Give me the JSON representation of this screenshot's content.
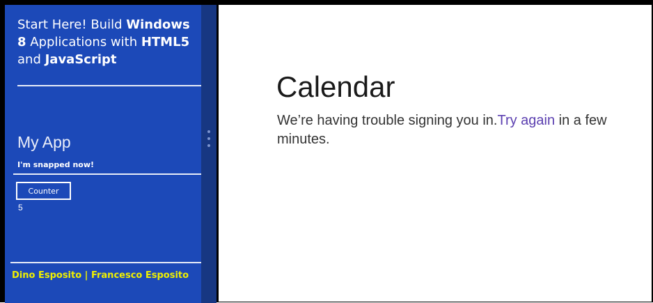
{
  "colors": {
    "snapped_panel": "#1c49b8",
    "splitter": "#173782",
    "author_text": "#f0f000",
    "link": "#5b3fb0"
  },
  "snapped_app": {
    "book_title": {
      "part1": "Start Here! Build ",
      "bold1": "Windows 8",
      "part2": " Applications with ",
      "bold2": "HTML5",
      "part3": " and ",
      "bold3": "JavaScript"
    },
    "app_title": "My App",
    "status_text": "I'm snapped now!",
    "counter_button_label": "Counter",
    "counter_value": "5",
    "authors": "Dino Esposito | Francesco Esposito"
  },
  "splitter": {
    "icon": "grip-dots-icon"
  },
  "calendar_app": {
    "title": "Calendar",
    "message_before": "We’re having trouble signing you in.",
    "retry_link": "Try again",
    "message_after": " in a few minutes."
  }
}
